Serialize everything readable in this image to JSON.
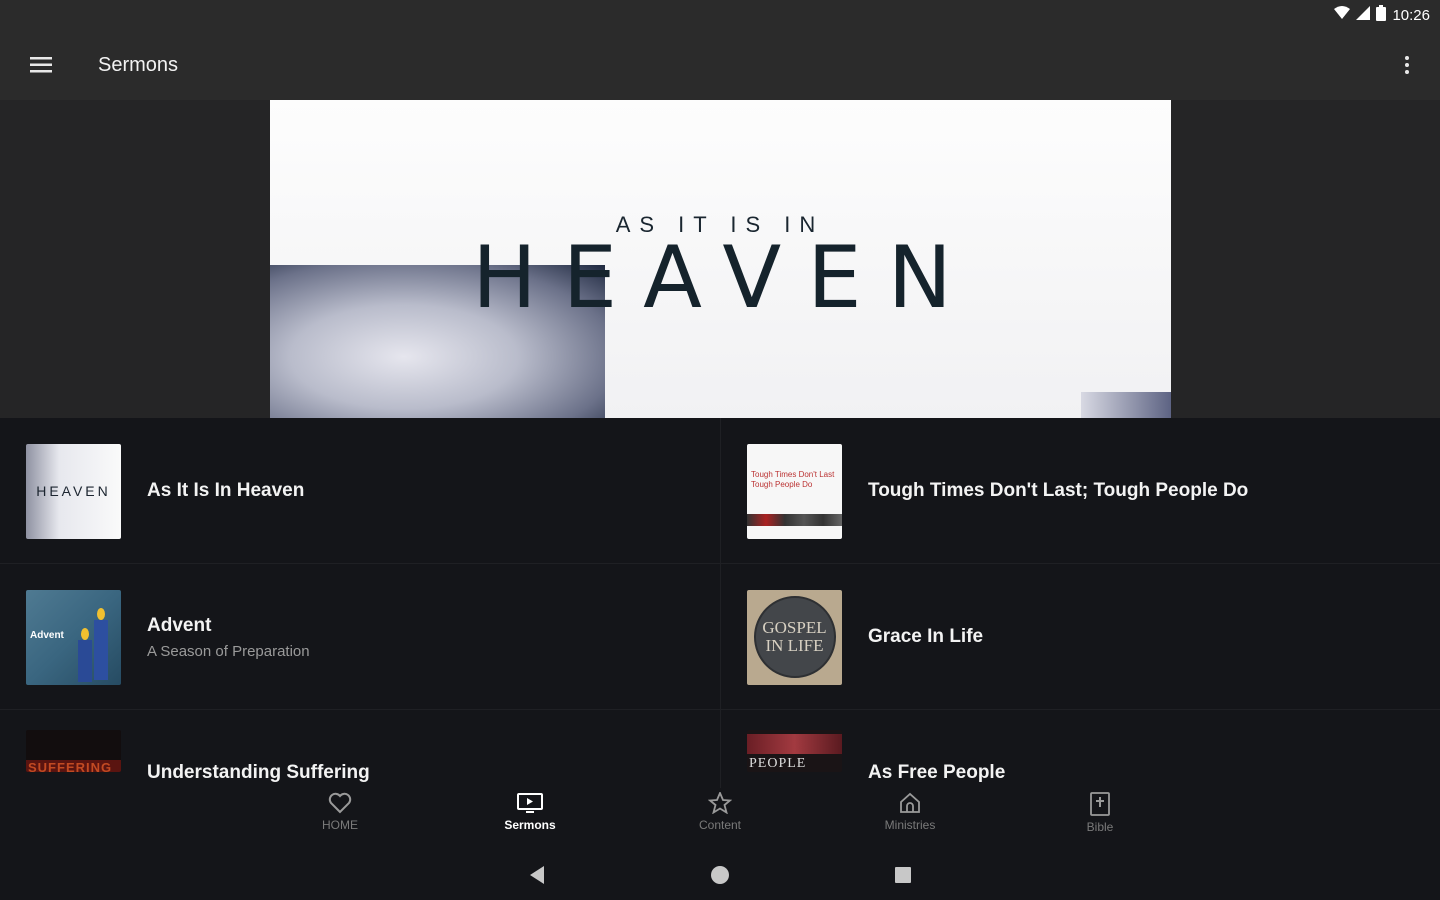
{
  "status_bar": {
    "time": "10:26"
  },
  "app_bar": {
    "title": "Sermons"
  },
  "hero": {
    "small_text": "AS IT IS IN",
    "big_text": "HEAVEN"
  },
  "sermons": [
    {
      "title": "As It Is In Heaven",
      "subtitle": "",
      "thumb_text": "HEAVEN"
    },
    {
      "title": "Tough Times Don't Last; Tough People Do",
      "subtitle": "",
      "thumb_text": "Tough Times Don't Last Tough People Do"
    },
    {
      "title": "Advent",
      "subtitle": "A Season of Preparation",
      "thumb_text": "Advent"
    },
    {
      "title": "Grace In Life",
      "subtitle": "",
      "thumb_text_1": "GOSPEL",
      "thumb_text_2": "IN LIFE"
    },
    {
      "title": "Understanding Suffering",
      "subtitle": "",
      "thumb_text": "SUFFERING"
    },
    {
      "title": "As Free People",
      "subtitle": "",
      "thumb_text": "PEOPLE"
    }
  ],
  "bottom_nav": [
    {
      "label": "HOME",
      "icon": "heart-icon"
    },
    {
      "label": "Sermons",
      "icon": "tv-icon",
      "active": true
    },
    {
      "label": "Content",
      "icon": "star-icon"
    },
    {
      "label": "Ministries",
      "icon": "home-icon"
    },
    {
      "label": "Bible",
      "icon": "bible-icon"
    }
  ],
  "colors": {
    "app_bar": "#2b2b2b",
    "list_bg": "#141519",
    "accent_active": "#ffffff"
  }
}
